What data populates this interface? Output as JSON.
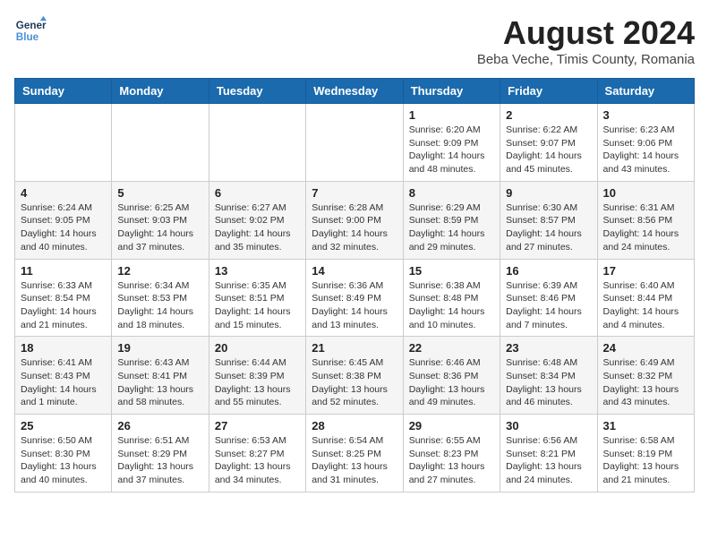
{
  "header": {
    "logo_line1": "General",
    "logo_line2": "Blue",
    "month_title": "August 2024",
    "location": "Beba Veche, Timis County, Romania"
  },
  "weekdays": [
    "Sunday",
    "Monday",
    "Tuesday",
    "Wednesday",
    "Thursday",
    "Friday",
    "Saturday"
  ],
  "weeks": [
    [
      {
        "day": "",
        "info": ""
      },
      {
        "day": "",
        "info": ""
      },
      {
        "day": "",
        "info": ""
      },
      {
        "day": "",
        "info": ""
      },
      {
        "day": "1",
        "info": "Sunrise: 6:20 AM\nSunset: 9:09 PM\nDaylight: 14 hours and 48 minutes."
      },
      {
        "day": "2",
        "info": "Sunrise: 6:22 AM\nSunset: 9:07 PM\nDaylight: 14 hours and 45 minutes."
      },
      {
        "day": "3",
        "info": "Sunrise: 6:23 AM\nSunset: 9:06 PM\nDaylight: 14 hours and 43 minutes."
      }
    ],
    [
      {
        "day": "4",
        "info": "Sunrise: 6:24 AM\nSunset: 9:05 PM\nDaylight: 14 hours and 40 minutes."
      },
      {
        "day": "5",
        "info": "Sunrise: 6:25 AM\nSunset: 9:03 PM\nDaylight: 14 hours and 37 minutes."
      },
      {
        "day": "6",
        "info": "Sunrise: 6:27 AM\nSunset: 9:02 PM\nDaylight: 14 hours and 35 minutes."
      },
      {
        "day": "7",
        "info": "Sunrise: 6:28 AM\nSunset: 9:00 PM\nDaylight: 14 hours and 32 minutes."
      },
      {
        "day": "8",
        "info": "Sunrise: 6:29 AM\nSunset: 8:59 PM\nDaylight: 14 hours and 29 minutes."
      },
      {
        "day": "9",
        "info": "Sunrise: 6:30 AM\nSunset: 8:57 PM\nDaylight: 14 hours and 27 minutes."
      },
      {
        "day": "10",
        "info": "Sunrise: 6:31 AM\nSunset: 8:56 PM\nDaylight: 14 hours and 24 minutes."
      }
    ],
    [
      {
        "day": "11",
        "info": "Sunrise: 6:33 AM\nSunset: 8:54 PM\nDaylight: 14 hours and 21 minutes."
      },
      {
        "day": "12",
        "info": "Sunrise: 6:34 AM\nSunset: 8:53 PM\nDaylight: 14 hours and 18 minutes."
      },
      {
        "day": "13",
        "info": "Sunrise: 6:35 AM\nSunset: 8:51 PM\nDaylight: 14 hours and 15 minutes."
      },
      {
        "day": "14",
        "info": "Sunrise: 6:36 AM\nSunset: 8:49 PM\nDaylight: 14 hours and 13 minutes."
      },
      {
        "day": "15",
        "info": "Sunrise: 6:38 AM\nSunset: 8:48 PM\nDaylight: 14 hours and 10 minutes."
      },
      {
        "day": "16",
        "info": "Sunrise: 6:39 AM\nSunset: 8:46 PM\nDaylight: 14 hours and 7 minutes."
      },
      {
        "day": "17",
        "info": "Sunrise: 6:40 AM\nSunset: 8:44 PM\nDaylight: 14 hours and 4 minutes."
      }
    ],
    [
      {
        "day": "18",
        "info": "Sunrise: 6:41 AM\nSunset: 8:43 PM\nDaylight: 14 hours and 1 minute."
      },
      {
        "day": "19",
        "info": "Sunrise: 6:43 AM\nSunset: 8:41 PM\nDaylight: 13 hours and 58 minutes."
      },
      {
        "day": "20",
        "info": "Sunrise: 6:44 AM\nSunset: 8:39 PM\nDaylight: 13 hours and 55 minutes."
      },
      {
        "day": "21",
        "info": "Sunrise: 6:45 AM\nSunset: 8:38 PM\nDaylight: 13 hours and 52 minutes."
      },
      {
        "day": "22",
        "info": "Sunrise: 6:46 AM\nSunset: 8:36 PM\nDaylight: 13 hours and 49 minutes."
      },
      {
        "day": "23",
        "info": "Sunrise: 6:48 AM\nSunset: 8:34 PM\nDaylight: 13 hours and 46 minutes."
      },
      {
        "day": "24",
        "info": "Sunrise: 6:49 AM\nSunset: 8:32 PM\nDaylight: 13 hours and 43 minutes."
      }
    ],
    [
      {
        "day": "25",
        "info": "Sunrise: 6:50 AM\nSunset: 8:30 PM\nDaylight: 13 hours and 40 minutes."
      },
      {
        "day": "26",
        "info": "Sunrise: 6:51 AM\nSunset: 8:29 PM\nDaylight: 13 hours and 37 minutes."
      },
      {
        "day": "27",
        "info": "Sunrise: 6:53 AM\nSunset: 8:27 PM\nDaylight: 13 hours and 34 minutes."
      },
      {
        "day": "28",
        "info": "Sunrise: 6:54 AM\nSunset: 8:25 PM\nDaylight: 13 hours and 31 minutes."
      },
      {
        "day": "29",
        "info": "Sunrise: 6:55 AM\nSunset: 8:23 PM\nDaylight: 13 hours and 27 minutes."
      },
      {
        "day": "30",
        "info": "Sunrise: 6:56 AM\nSunset: 8:21 PM\nDaylight: 13 hours and 24 minutes."
      },
      {
        "day": "31",
        "info": "Sunrise: 6:58 AM\nSunset: 8:19 PM\nDaylight: 13 hours and 21 minutes."
      }
    ]
  ]
}
